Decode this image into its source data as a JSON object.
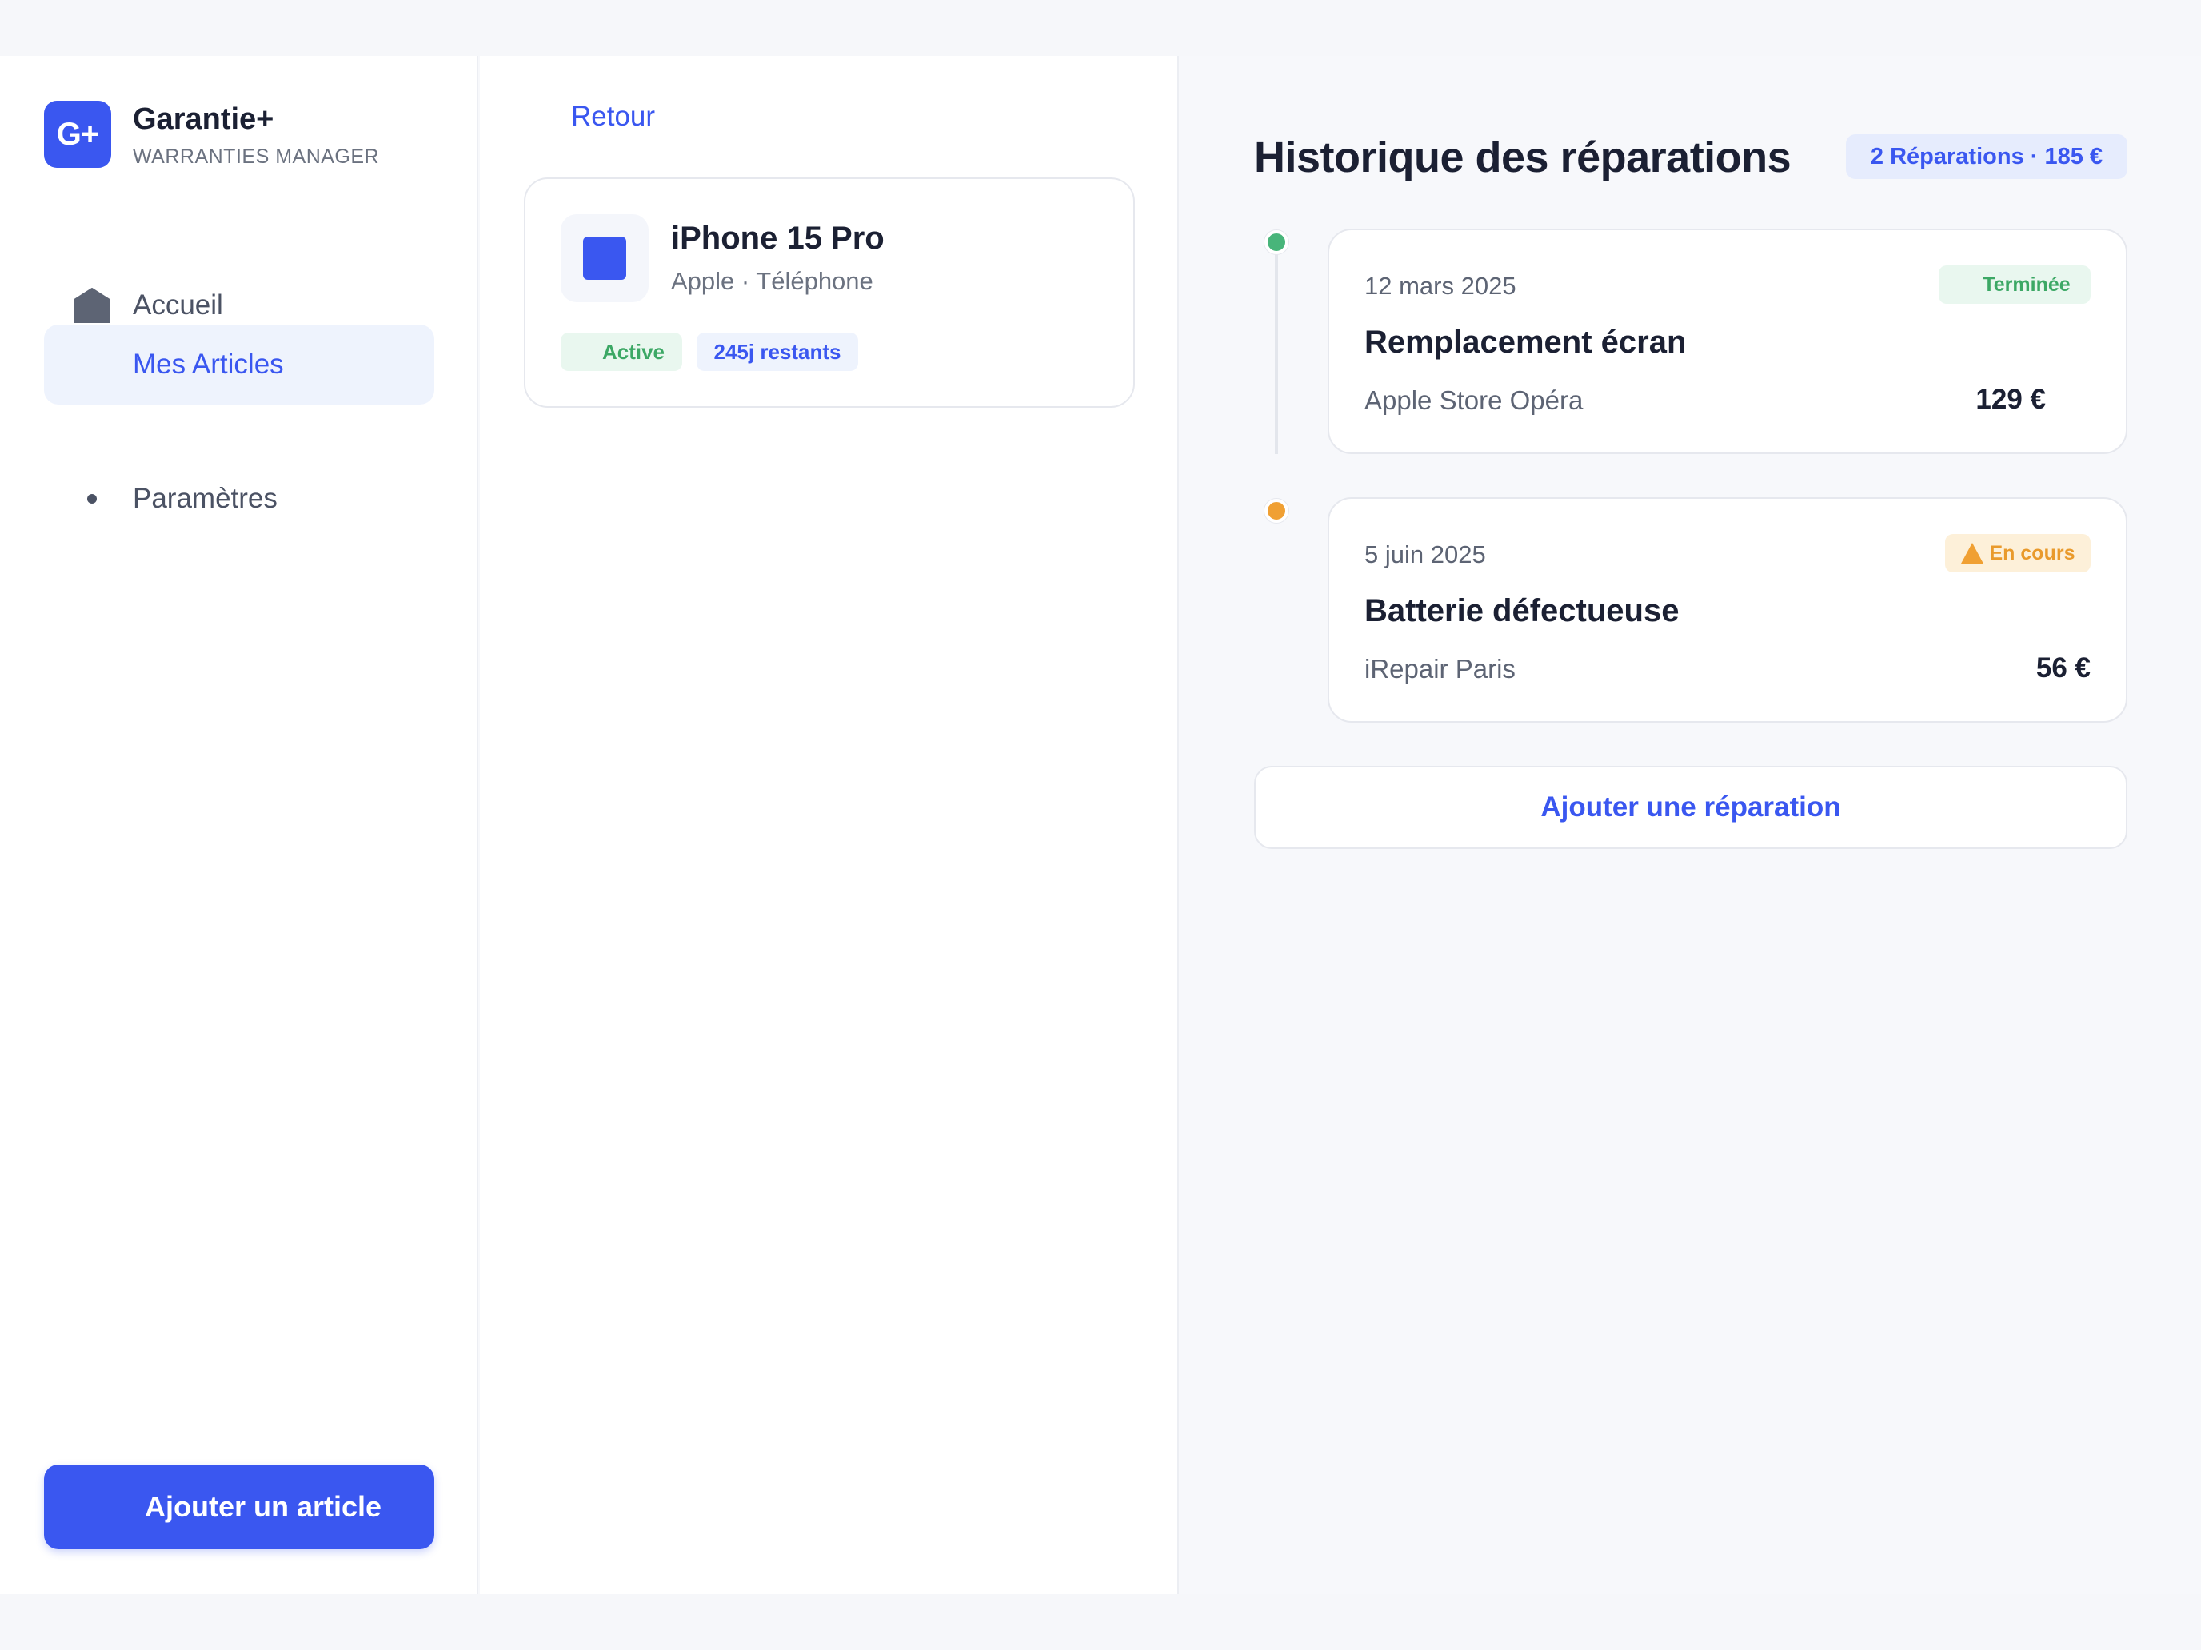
{
  "brand": {
    "logo": "G+",
    "title": "Garantie+",
    "subtitle": "WARRANTIES MANAGER"
  },
  "sidebar": {
    "items": [
      {
        "label": "Accueil",
        "icon": "home-icon",
        "active": false
      },
      {
        "label": "Mes Articles",
        "icon": "",
        "active": true
      },
      {
        "label": "Paramètres",
        "icon": "dot-icon",
        "active": false
      }
    ],
    "add_button": "Ajouter un article"
  },
  "article": {
    "back": "Retour",
    "name": "iPhone 15 Pro",
    "meta": "Apple · Téléphone",
    "status": "Active",
    "remaining": "245j restants"
  },
  "history": {
    "title": "Historique des réparations",
    "summary": "2 Réparations · 185 €",
    "repairs": [
      {
        "date": "12 mars 2025",
        "title": "Remplacement écran",
        "shop": "Apple Store Opéra",
        "price": "129 €",
        "status": "Terminée",
        "status_color": "#3ca865"
      },
      {
        "date": "5 juin 2025",
        "title": "Batterie défectueuse",
        "shop": "iRepair Paris",
        "price": "56 €",
        "status": "En cours",
        "status_color": "#e99a2c"
      }
    ],
    "add_button": "Ajouter une réparation"
  },
  "colors": {
    "accent": "#3a57f0",
    "success": "#3ca865",
    "warning": "#e99a2c",
    "text": "#1b2033"
  }
}
